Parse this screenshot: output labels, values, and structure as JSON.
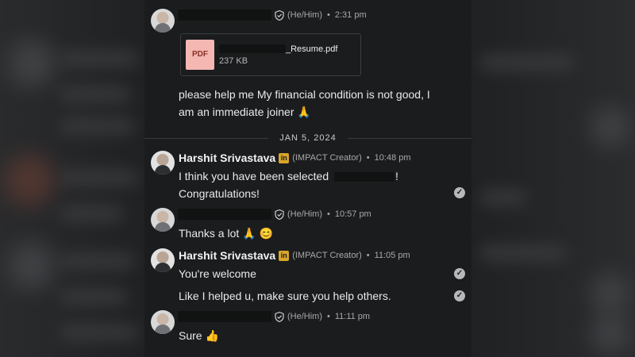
{
  "message1": {
    "pronouns": "(He/Him)",
    "time": "2:31 pm",
    "attachment": {
      "type": "PDF",
      "name": "_Resume.pdf",
      "size": "237 KB"
    },
    "text": "please help me My financial condition is not good, I am an immediate joiner 🙏"
  },
  "date_divider": "JAN 5, 2024",
  "message2": {
    "sender": "Harshit Srivastava",
    "badge": "in",
    "role": "(IMPACT Creator)",
    "time": "10:48 pm",
    "line1_a": "I think you have been selected",
    "line1_b": "!",
    "line2": "Congratulations!"
  },
  "message3": {
    "pronouns": "(He/Him)",
    "time": "10:57 pm",
    "text": "Thanks a lot",
    "emojis": "🙏 😊"
  },
  "message4": {
    "sender": "Harshit Srivastava",
    "badge": "in",
    "role": "(IMPACT Creator)",
    "time": "11:05 pm",
    "line1": "You're welcome",
    "line2": "Like I helped u, make sure you help others."
  },
  "message5": {
    "pronouns": "(He/Him)",
    "time": "11:11 pm",
    "text": "Sure",
    "emoji": "👍"
  },
  "symbols": {
    "dot": "•",
    "check": "✓"
  }
}
